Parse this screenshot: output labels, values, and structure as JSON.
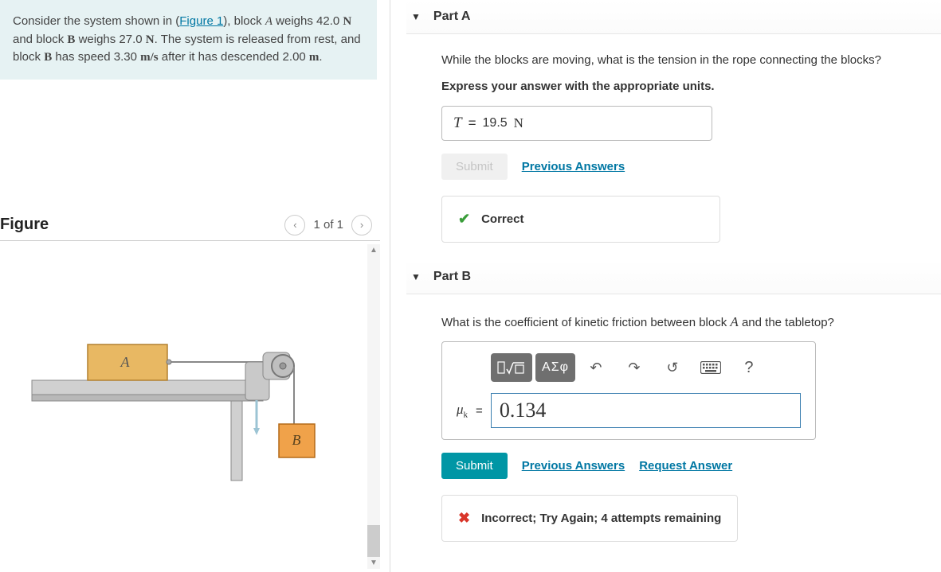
{
  "problem": {
    "text_pre": "Consider the system shown in (",
    "figure_link": "Figure 1",
    "text_mid1": "), block ",
    "blockA": "A",
    "text_mid2": " weighs 42.0 ",
    "N": "N",
    "text_mid3": " and block ",
    "blockB": "B",
    "text_mid4": " weighs 27.0 ",
    "text_mid5": ". The system is released from rest, and block ",
    "text_mid6": " has speed 3.30 ",
    "ms": "m/s",
    "text_mid7": " after it has descended 2.00 ",
    "m": "m",
    "text_end": "."
  },
  "figure": {
    "title": "Figure",
    "pager": "1 of 1",
    "labelA": "A",
    "labelB": "B"
  },
  "partA": {
    "title": "Part A",
    "question": "While the blocks are moving, what is the tension in the rope connecting the blocks?",
    "instruction": "Express your answer with the appropriate units.",
    "var": "T",
    "equals": "=",
    "value": "19.5",
    "unit": "N",
    "submit": "Submit",
    "prev": "Previous Answers",
    "feedback": "Correct"
  },
  "partB": {
    "title": "Part B",
    "question_pre": "What is the coefficient of kinetic friction between block ",
    "question_block": "A",
    "question_post": " and the tabletop?",
    "toolbar": {
      "template": "x√x",
      "greek": "ΑΣφ",
      "undo": "↶",
      "redo": "↷",
      "reset": "↺",
      "keyboard": "⌨",
      "help": "?"
    },
    "var": "μ",
    "sub": "k",
    "equals": "=",
    "value": "0.134",
    "submit": "Submit",
    "prev": "Previous Answers",
    "request": "Request Answer",
    "feedback": "Incorrect; Try Again; 4 attempts remaining"
  }
}
